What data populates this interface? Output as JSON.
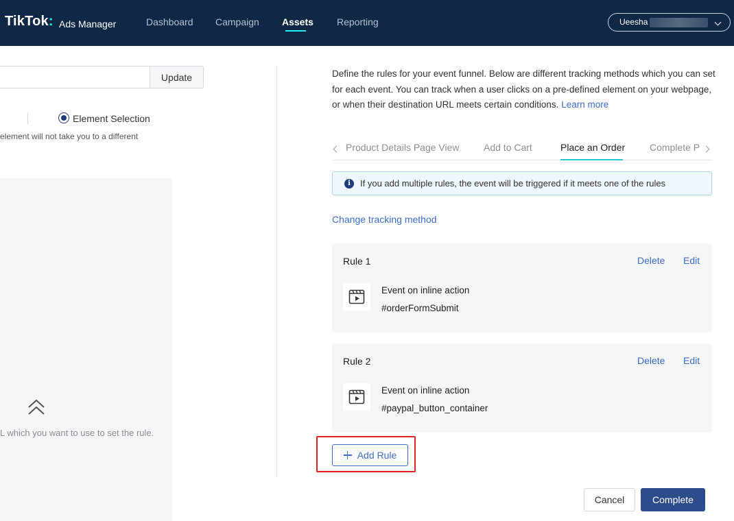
{
  "header": {
    "logo": "TikTok",
    "logo_dot": ":",
    "logo_sub": "Ads Manager",
    "nav": [
      "Dashboard",
      "Campaign",
      "Assets",
      "Reporting"
    ],
    "active_nav": "Assets",
    "account_name": "Ueesha",
    "account_icon": "chevron-down-icon"
  },
  "left": {
    "url_value": "",
    "update_label": "Update",
    "radio_label": "Element Selection",
    "hint": "element will not take you to a different",
    "preview_text": "L which you want to use to set the rule.",
    "preview_icon": "double-chevron-up-icon"
  },
  "right": {
    "description": "Define the rules for your event funnel. Below are different tracking methods which you can set for each event. You can track when a user clicks on a pre-defined element on your webpage, or when their destination URL meets certain conditions.",
    "learn_more": "Learn more",
    "tabs": [
      "Product Details Page View",
      "Add to Cart",
      "Place an Order",
      "Complete P"
    ],
    "active_tab": "Place an Order",
    "info_text": "If you add multiple rules, the event will be triggered if it meets one of the rules",
    "change_link": "Change tracking method",
    "rules": [
      {
        "title": "Rule 1",
        "delete": "Delete",
        "edit": "Edit",
        "line1": "Event on inline action",
        "line2": "#orderFormSubmit"
      },
      {
        "title": "Rule 2",
        "delete": "Delete",
        "edit": "Edit",
        "line1": "Event on inline action",
        "line2": "#paypal_button_container"
      }
    ],
    "add_rule": "Add Rule",
    "cancel": "Cancel",
    "complete": "Complete"
  },
  "colors": {
    "header_bg": "#0f2846",
    "accent": "#25f4ee",
    "link": "#3b6dc4",
    "primary": "#2d4c8c",
    "highlight": "#e02424"
  }
}
